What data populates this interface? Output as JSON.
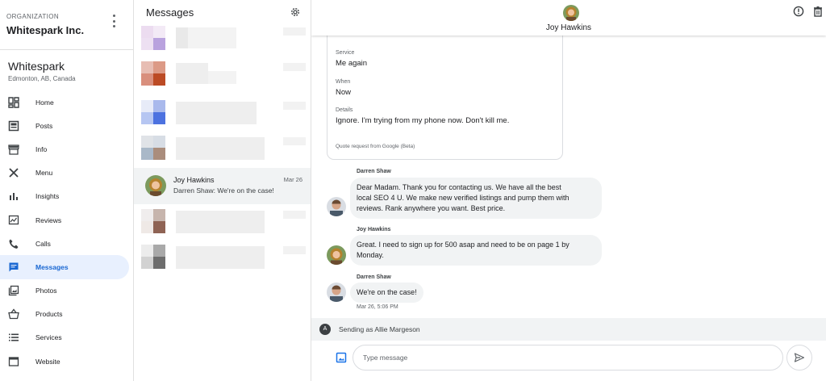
{
  "organization": {
    "label": "ORGANIZATION",
    "name": "Whitespark Inc.",
    "menu_icon": "more-vert-icon"
  },
  "business": {
    "name": "Whitespark",
    "location": "Edmonton, AB, Canada"
  },
  "nav": {
    "items": [
      {
        "label": "Home",
        "icon": "dashboard-icon"
      },
      {
        "label": "Posts",
        "icon": "posts-icon"
      },
      {
        "label": "Info",
        "icon": "storefront-icon"
      },
      {
        "label": "Menu",
        "icon": "utensils-icon"
      },
      {
        "label": "Insights",
        "icon": "bar-chart-icon"
      },
      {
        "label": "Reviews",
        "icon": "rate-review-icon"
      },
      {
        "label": "Calls",
        "icon": "phone-icon"
      },
      {
        "label": "Messages",
        "icon": "chat-icon",
        "active": true
      },
      {
        "label": "Photos",
        "icon": "photo-library-icon"
      },
      {
        "label": "Products",
        "icon": "shopping-basket-icon"
      },
      {
        "label": "Services",
        "icon": "list-icon"
      },
      {
        "label": "Website",
        "icon": "web-icon"
      }
    ],
    "active_color": "#1967d2",
    "active_bg": "#e8f0fe"
  },
  "conversations": {
    "title": "Messages",
    "settings_icon": "gear-icon",
    "active": {
      "name": "Joy Hawkins",
      "date": "Mar 26",
      "preview": "Darren Shaw: We're on the case!"
    }
  },
  "chat": {
    "contact_name": "Joy Hawkins",
    "header_actions": [
      "info-icon",
      "delete-icon"
    ],
    "quote": {
      "fields": [
        {
          "label": "Service",
          "value": "Me again"
        },
        {
          "label": "When",
          "value": "Now"
        },
        {
          "label": "Details",
          "value": "Ignore. I'm trying from my phone now. Don't kill me."
        }
      ],
      "source": "Quote request from Google (Beta)"
    },
    "messages": [
      {
        "sender": "Darren Shaw",
        "lines": [
          "Dear Madam. Thank you for contacting us. We have all the best",
          "local SEO 4 U. We make new verified listings and pump them with",
          "reviews. Rank anywhere you want. Best price."
        ]
      },
      {
        "sender": "Joy Hawkins",
        "lines": [
          "Great. I need to sign up for 500 asap and need to be on page 1 by",
          "Monday."
        ]
      },
      {
        "sender": "Darren Shaw",
        "lines": [
          "We're on the case!"
        ],
        "time": "Mar 26, 5:06 PM"
      }
    ],
    "sending_as": "Sending as Allie Margeson",
    "sending_avatar_initial": "A",
    "composer_placeholder": "Type message",
    "attach_icon": "image-icon",
    "send_icon": "send-icon",
    "accent": "#1a73e8"
  }
}
